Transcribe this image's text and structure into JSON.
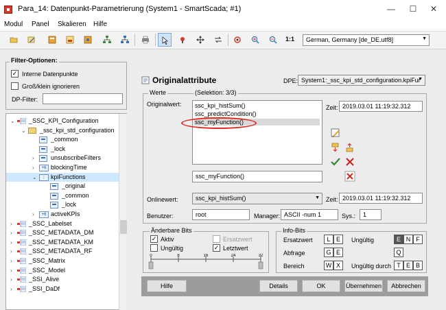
{
  "window": {
    "title": "Para_14: Datenpunkt-Parametrierung (System1 - SmartScada; #1)",
    "minimize": "—",
    "maximize": "☐",
    "close": "✕"
  },
  "menu": [
    "Modul",
    "Panel",
    "Skalieren",
    "Hilfe"
  ],
  "toolbar": {
    "icons": [
      "folder-open-icon",
      "edit-icon",
      "dp-icon",
      "type-icon",
      "tree-icon",
      "network-icon",
      "print-icon",
      "select-icon",
      "tool-icon",
      "move-icon",
      "swap-icon",
      "config-icon",
      "zoom-in-icon",
      "zoom-out-icon",
      "zoom-reset-icon"
    ],
    "zoom_reset_label": "1:1",
    "language": "German, Germany [de_DE.utf8]"
  },
  "filter": {
    "title": "Filter-Optionen:",
    "internal_label": "Interne Datenpunkte",
    "internal_checked": true,
    "case_label": "Groß/klein ignorieren",
    "case_checked": false,
    "dp_filter_label": "DP-Filter:",
    "dp_filter_value": ""
  },
  "tree": [
    {
      "label": "_SSC_KPI_Configuration",
      "level": 0,
      "expanded": true,
      "icon": "dp"
    },
    {
      "label": "_ssc_kpi_std_configuration",
      "level": 1,
      "expanded": true,
      "icon": "folder"
    },
    {
      "label": "_common",
      "level": 2,
      "icon": "node"
    },
    {
      "label": "_lock",
      "level": 2,
      "icon": "node"
    },
    {
      "label": "unsubscribeFilters",
      "level": 2,
      "expanded": false,
      "icon": "node"
    },
    {
      "label": "blockingTime",
      "level": 2,
      "expanded": false,
      "icon": "type",
      "type_text": "+6"
    },
    {
      "label": "kpiFunctions",
      "level": 2,
      "expanded": true,
      "icon": "type",
      "type_text": "⋮",
      "selected": true
    },
    {
      "label": "_original",
      "level": 3,
      "icon": "node"
    },
    {
      "label": "_common",
      "level": 3,
      "icon": "node"
    },
    {
      "label": "_lock",
      "level": 3,
      "icon": "node"
    },
    {
      "label": "activeKPIs",
      "level": 2,
      "expanded": false,
      "icon": "type",
      "type_text": "+6"
    },
    {
      "label": "_SSC_Labelset",
      "level": 0,
      "expanded": false,
      "icon": "dp"
    },
    {
      "label": "_SSC_METADATA_DM",
      "level": 0,
      "expanded": false,
      "icon": "dp"
    },
    {
      "label": "_SSC_METADATA_KM",
      "level": 0,
      "expanded": false,
      "icon": "dp"
    },
    {
      "label": "_SSC_METADATA_RF",
      "level": 0,
      "expanded": false,
      "icon": "dp"
    },
    {
      "label": "_SSC_Matrix",
      "level": 0,
      "expanded": false,
      "icon": "dp"
    },
    {
      "label": "_SSC_Model",
      "level": 0,
      "expanded": false,
      "icon": "dp"
    },
    {
      "label": "_SSI_Alive",
      "level": 0,
      "expanded": false,
      "icon": "dp"
    },
    {
      "label": "_SSI_DaDf",
      "level": 0,
      "expanded": false,
      "icon": "dp"
    }
  ],
  "panel": {
    "title": "Originalattribute",
    "dpe_label": "DPE:",
    "dpe_value": "System1:_ssc_kpi_std_configuration.kpiFur",
    "werte_title": "Werte",
    "selection": "(Selektion: 3/3)",
    "originalwert_label": "Originalwert:",
    "list_items": [
      "ssc_kpi_histSum()",
      "ssc_predictCondition()",
      "ssc_myFunction()"
    ],
    "selected_index": 2,
    "zeit_label": "Zeit:",
    "zeit_value": "2019.03.01 11:19:32.312",
    "value_edit": "ssc_myFunction()",
    "onlinewert_label": "Onlinewert:",
    "onlinewert_value": "ssc_kpi_histSum()",
    "online_zeit_value": "2019.03.01 11:19:32.312",
    "benutzer_label": "Benutzer:",
    "benutzer_value": "root",
    "manager_label": "Manager:",
    "manager_value": "ASCII -num 1",
    "sys_label": "Sys.:",
    "sys_value": "1"
  },
  "bits": {
    "title": "Änderbare Bits",
    "aktiv_label": "Aktiv",
    "aktiv_checked": true,
    "ersatzwert_label": "Ersatzwert",
    "ersatzwert_checked": false,
    "ungueltig_label": "Ungültig",
    "ungueltig_checked": false,
    "letztwert_label": "Letztwert",
    "letztwert_checked": true,
    "scale": [
      "0",
      "8",
      "16",
      "24",
      "32"
    ]
  },
  "info_bits": {
    "title": "Info-Bits",
    "ersatzwert_label": "Ersatzwert",
    "ersatzwert_boxes": [
      "L",
      "E"
    ],
    "ungueltig_label": "Ungültig",
    "ungueltig_boxes": [
      "E",
      "N",
      "F"
    ],
    "abfrage_label": "Abfrage",
    "abfrage_boxes": [
      "G",
      "E"
    ],
    "q_box": "Q",
    "bereich_label": "Bereich",
    "bereich_boxes": [
      "W",
      "X"
    ],
    "ungueltig_durch_label": "Ungültig durch",
    "ungueltig_durch_boxes": [
      "T",
      "E",
      "B"
    ]
  },
  "footer": {
    "hilfe": "Hilfe",
    "details": "Details",
    "ok": "OK",
    "uebernehmen": "Übernehmen",
    "abbrechen": "Abbrechen"
  },
  "colors": {
    "highlight_ellipse": "#e0281f",
    "selection": "#cde8ff"
  }
}
